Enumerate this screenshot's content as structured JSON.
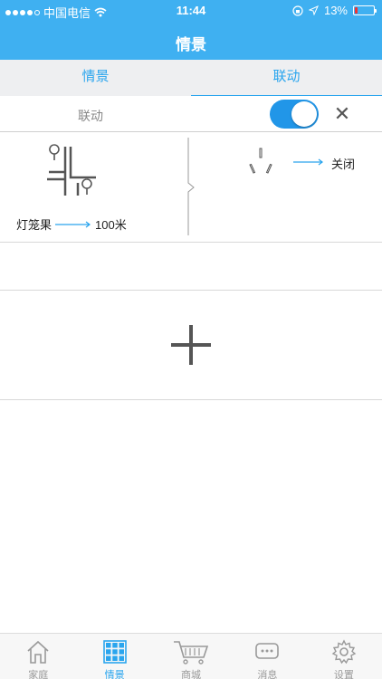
{
  "status_bar": {
    "carrier": "中国电信",
    "time": "11:44",
    "battery_percent": "13%",
    "battery_level": 0.13
  },
  "nav": {
    "title": "情景"
  },
  "tabs": [
    {
      "label": "情景",
      "active": false
    },
    {
      "label": "联动",
      "active": true
    }
  ],
  "linkage_row": {
    "label": "联动",
    "toggle_on": true
  },
  "rule": {
    "condition_device": "灯笼果",
    "condition_value": "100米",
    "action_value": "关闭"
  },
  "bottom_nav": [
    {
      "label": "家庭",
      "icon": "home-icon",
      "active": false
    },
    {
      "label": "情景",
      "icon": "grid-icon",
      "active": true
    },
    {
      "label": "商城",
      "icon": "cart-icon",
      "active": false
    },
    {
      "label": "消息",
      "icon": "message-icon",
      "active": false
    },
    {
      "label": "设置",
      "icon": "settings-icon",
      "active": false
    }
  ],
  "colors": {
    "accent": "#3fb0f1",
    "tab_text": "#2aa5ee",
    "toggle": "#2196e8"
  }
}
